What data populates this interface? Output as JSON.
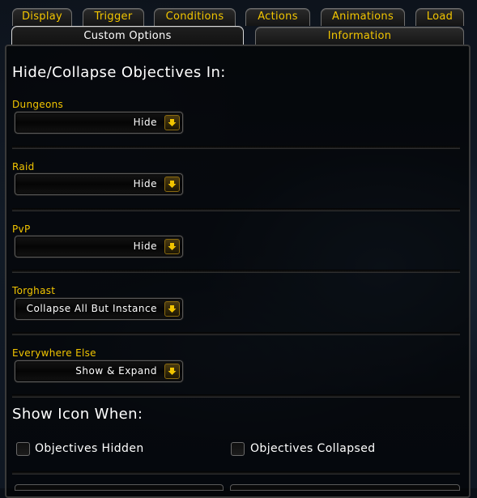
{
  "tabs_row1": [
    {
      "label": "Display"
    },
    {
      "label": "Trigger"
    },
    {
      "label": "Conditions"
    },
    {
      "label": "Actions"
    },
    {
      "label": "Animations"
    },
    {
      "label": "Load"
    }
  ],
  "tabs_row2": [
    {
      "label": "Custom Options",
      "active": true
    },
    {
      "label": "Information",
      "active": false
    }
  ],
  "section1": {
    "heading": "Hide/Collapse Objectives In:",
    "settings": [
      {
        "label": "Dungeons",
        "value": "Hide"
      },
      {
        "label": "Raid",
        "value": "Hide"
      },
      {
        "label": "PvP",
        "value": "Hide"
      },
      {
        "label": "Torghast",
        "value": "Collapse All But Instance"
      },
      {
        "label": "Everywhere Else",
        "value": "Show & Expand"
      }
    ]
  },
  "section2": {
    "heading": "Show Icon When:",
    "options": [
      {
        "label": "Objectives Hidden",
        "checked": false
      },
      {
        "label": "Objectives Collapsed",
        "checked": false
      }
    ]
  },
  "colors": {
    "label_gold": "#f2c500",
    "text_white": "#ffffff",
    "panel_bg": "#000000"
  },
  "icons": {
    "dropdown_toggle": "arrow-down-icon"
  }
}
